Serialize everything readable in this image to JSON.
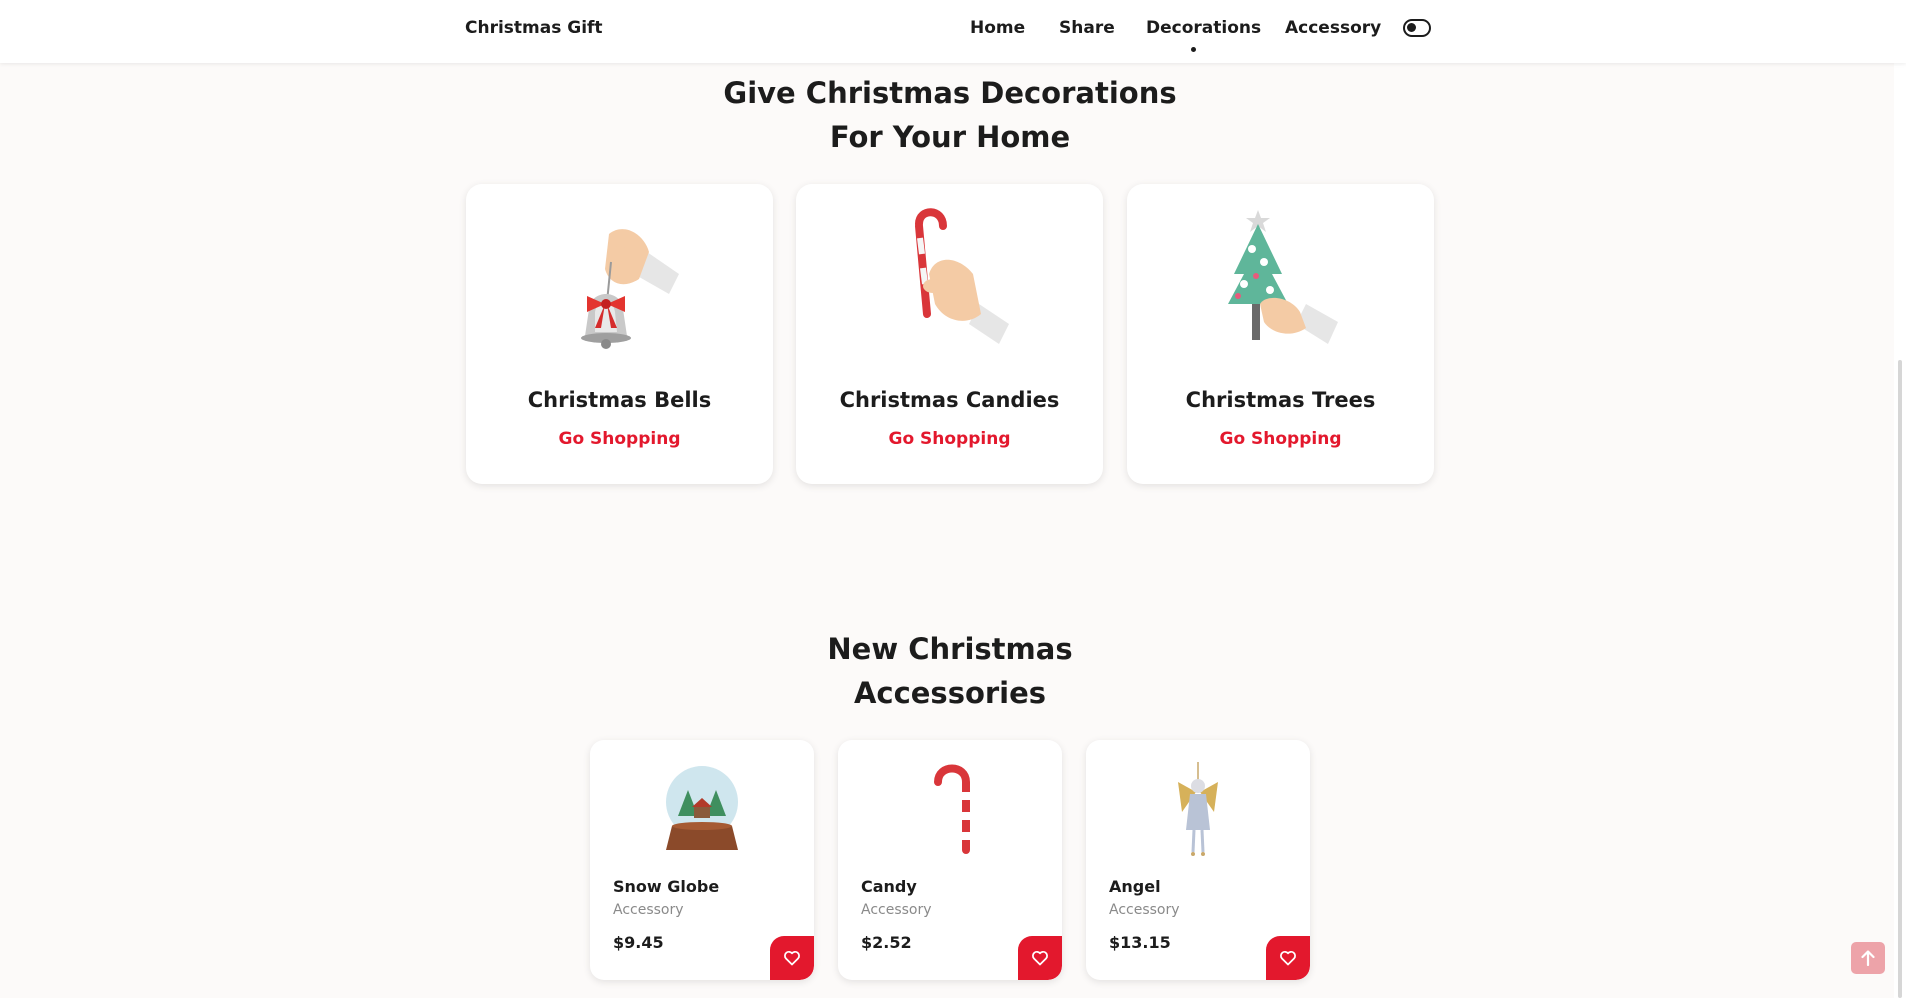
{
  "header": {
    "logo": "Christmas Gift",
    "nav": [
      {
        "label": "Home"
      },
      {
        "label": "Share"
      },
      {
        "label": "Decorations",
        "active": true
      },
      {
        "label": "Accessory"
      }
    ],
    "theme_toggle_icon": "toggle-icon"
  },
  "decorations": {
    "title_line1": "Give Christmas Decorations",
    "title_line2": "For Your Home",
    "cards": [
      {
        "name": "Christmas Bells",
        "link": "Go Shopping",
        "icon": "bell-icon"
      },
      {
        "name": "Christmas Candies",
        "link": "Go Shopping",
        "icon": "candy-cane-icon"
      },
      {
        "name": "Christmas Trees",
        "link": "Go Shopping",
        "icon": "christmas-tree-icon"
      }
    ]
  },
  "accessories": {
    "title_line1": "New Christmas",
    "title_line2": "Accessories",
    "items": [
      {
        "name": "Snow Globe",
        "category": "Accessory",
        "price": "$9.45",
        "icon": "snow-globe-icon"
      },
      {
        "name": "Candy",
        "category": "Accessory",
        "price": "$2.52",
        "icon": "candy-cane-icon"
      },
      {
        "name": "Angel",
        "category": "Accessory",
        "price": "$13.15",
        "icon": "angel-icon"
      }
    ]
  },
  "colors": {
    "accent": "#e3182d",
    "background": "#fcfaf9",
    "text": "#1c1c1c",
    "scroll_up_bg": "#eda3a9"
  }
}
